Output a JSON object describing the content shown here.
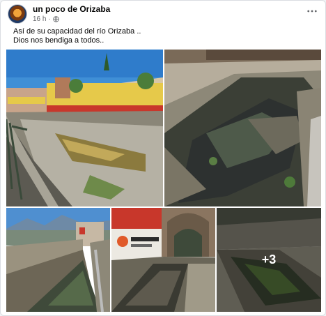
{
  "post": {
    "page_name": "un poco de Orizaba",
    "time": "16 h",
    "text_line1": "Así  de su capacidad del río Orizaba ..",
    "text_line2": "Dios nos bendiga a todos.."
  },
  "gallery": {
    "more_count": "+3"
  },
  "icons": {
    "options": "more-options-icon",
    "audience": "globe-icon"
  },
  "colors": {
    "name_text": "#050505",
    "meta_text": "#65676b"
  }
}
